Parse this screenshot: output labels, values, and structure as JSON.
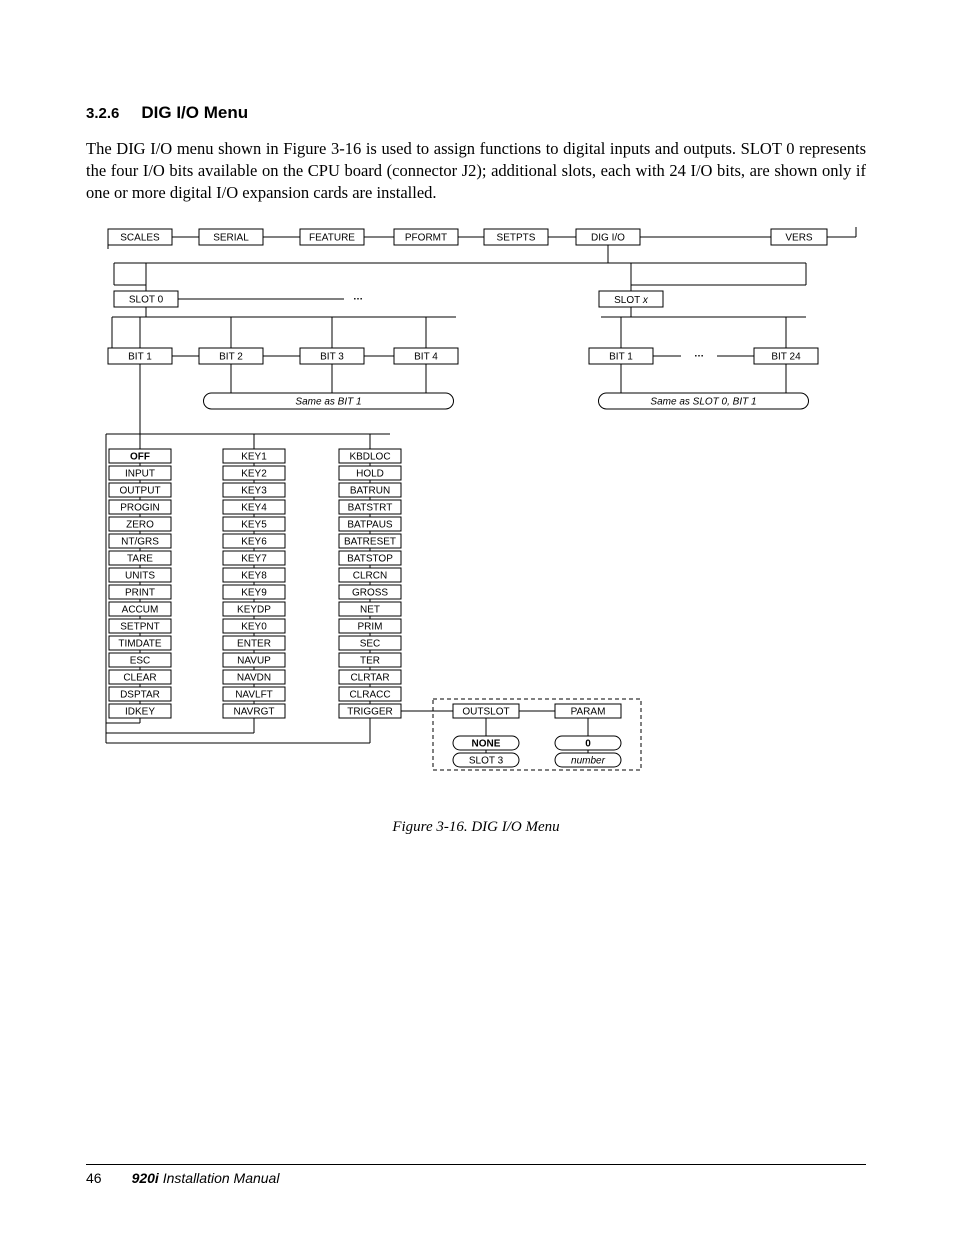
{
  "section": {
    "number": "3.2.6",
    "title": "DIG I/O Menu"
  },
  "para": "The DIG I/O menu shown in Figure 3-16 is used to assign functions to digital inputs and outputs. SLOT 0 represents the four I/O bits available on the CPU board (connector J2); additional slots, each with 24 I/O bits, are shown only if one or more digital I/O expansion cards are installed.",
  "caption": "Figure 3-16. DIG I/O Menu",
  "footer": {
    "page": "46",
    "model": "920i",
    "manual": " Installation Manual"
  },
  "diagram": {
    "row1": [
      "SCALES",
      "SERIAL",
      "FEATURE",
      "PFORMT",
      "SETPTS",
      "DIG I/O",
      "VERS"
    ],
    "row2": {
      "left": "SLOT 0",
      "right_prefix": "SLOT ",
      "right_var": "x",
      "ellipsis": "…"
    },
    "row3_left": [
      "BIT 1",
      "BIT 2",
      "BIT 3",
      "BIT 4"
    ],
    "row3_right": {
      "left": "BIT 1",
      "right": "BIT 24",
      "ellipsis": "…"
    },
    "notes": {
      "left": "Same as BIT 1",
      "right": "Same as SLOT 0, BIT 1"
    },
    "colA": [
      "OFF",
      "INPUT",
      "OUTPUT",
      "PROGIN",
      "ZERO",
      "NT/GRS",
      "TARE",
      "UNITS",
      "PRINT",
      "ACCUM",
      "SETPNT",
      "TIMDATE",
      "ESC",
      "CLEAR",
      "DSPTAR",
      "IDKEY"
    ],
    "colB": [
      "KEY1",
      "KEY2",
      "KEY3",
      "KEY4",
      "KEY5",
      "KEY6",
      "KEY7",
      "KEY8",
      "KEY9",
      "KEYDP",
      "KEY0",
      "ENTER",
      "NAVUP",
      "NAVDN",
      "NAVLFT",
      "NAVRGT"
    ],
    "colC": [
      "KBDLOC",
      "HOLD",
      "BATRUN",
      "BATSTRT",
      "BATPAUS",
      "BATRESET",
      "BATSTOP",
      "CLRCN",
      "GROSS",
      "NET",
      "PRIM",
      "SEC",
      "TER",
      "CLRTAR",
      "CLRACC",
      "TRIGGER"
    ],
    "trigger": {
      "outslot": "OUTSLOT",
      "param": "PARAM",
      "none": "NONE",
      "zero": "0",
      "slot3": "SLOT 3",
      "number": "number"
    }
  }
}
